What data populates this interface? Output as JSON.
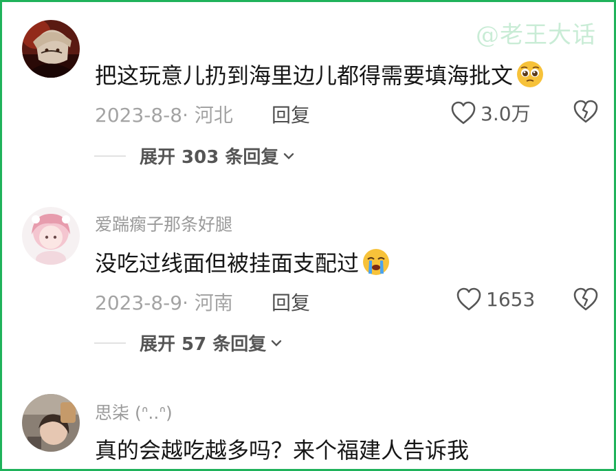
{
  "watermark": "@老王大话",
  "comments": [
    {
      "username": "",
      "text": "把这玩意儿扔到海里边儿都得需要填海批文",
      "emoji": "pleading-face-emoji",
      "date_location": "2023-8-8· 河北",
      "reply_label": "回复",
      "likes": "3.0万",
      "expand_label": "展开 303 条回复"
    },
    {
      "username": "爱踹瘸子那条好腿",
      "text": "没吃过线面但被挂面支配过",
      "emoji": "crying-face-emoji",
      "date_location": "2023-8-9· 河南",
      "reply_label": "回复",
      "likes": "1653",
      "expand_label": "展开 57 条回复"
    },
    {
      "username": "思柒 (ᐢ..ᐢ)",
      "text": "真的会越吃越多吗？来个福建人告诉我"
    }
  ],
  "colors": {
    "frame": "#1fb25a",
    "watermark": "#c9ecd6",
    "secondary_text": "#a3a3a3",
    "primary_text": "#161616"
  }
}
